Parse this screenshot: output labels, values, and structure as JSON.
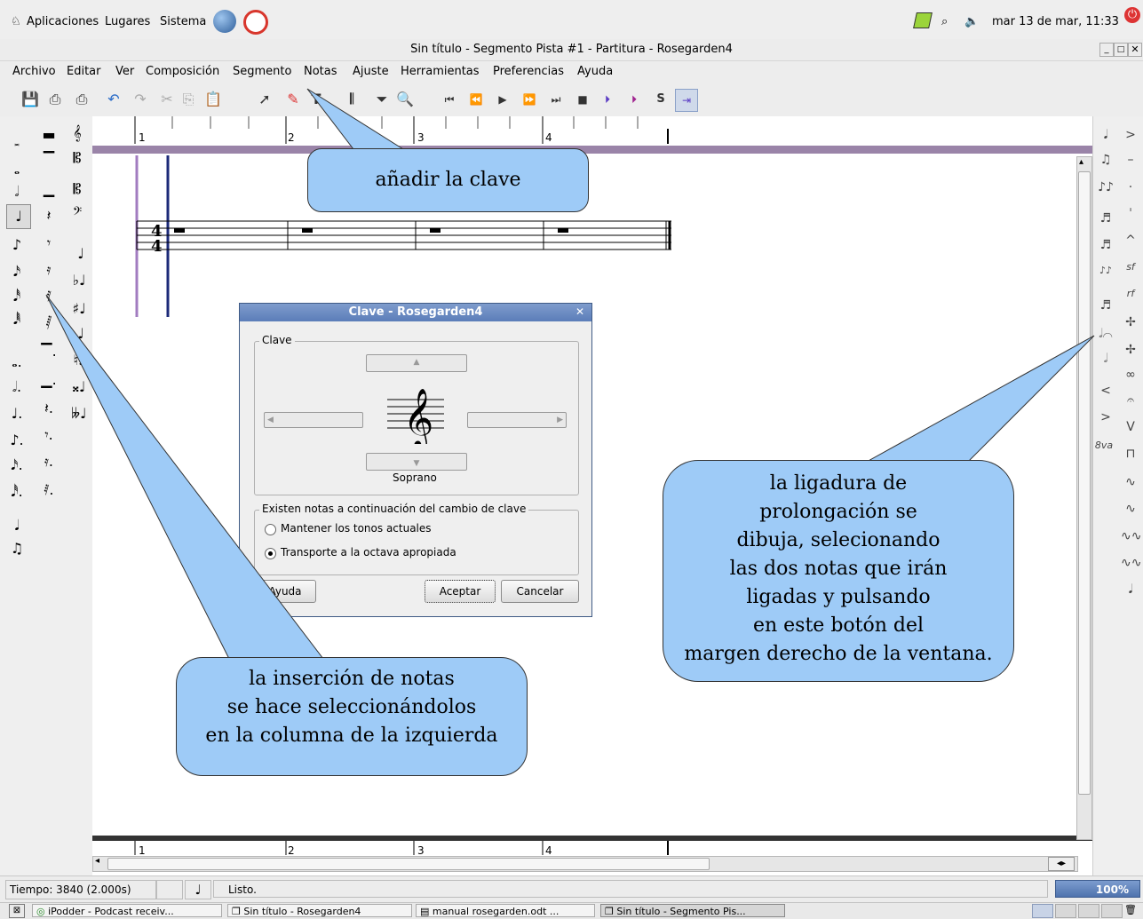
{
  "panel": {
    "applications": "Aplicaciones",
    "places": "Lugares",
    "system": "Sistema",
    "datetime": "mar 13 de mar, 11:33"
  },
  "window": {
    "title": "Sin título - Segmento Pista #1 - Partitura - Rosegarden4"
  },
  "menu": [
    "Archivo",
    "Editar",
    "Ver",
    "Composición",
    "Segmento",
    "Notas",
    "Ajuste",
    "Herramientas",
    "Preferencias",
    "Ayuda"
  ],
  "ruler": {
    "measures": [
      "1",
      "2",
      "3",
      "4"
    ]
  },
  "time_signature": {
    "top": "4",
    "bottom": "4"
  },
  "dialog": {
    "title": "Clave - Rosegarden4",
    "group_clef": "Clave",
    "clef_name": "Soprano",
    "group_notes": "Existen notas a continuación del cambio de clave",
    "option_keep": "Mantener los tonos actuales",
    "option_transpose": "Transporte a la octava apropiada",
    "selected_option": "transpose",
    "help": "Ayuda",
    "accept": "Aceptar",
    "cancel": "Cancelar"
  },
  "callouts": {
    "clef": "añadir la clave",
    "notes": [
      "la inserción de notas",
      "se hace seleccionándolos",
      "en la columna de la izquierda"
    ],
    "tie": [
      "la ligadura de",
      "prolongación se",
      "dibuja, selecionando",
      "las dos notas que irán",
      "ligadas y pulsando",
      "en este botón del",
      "margen derecho de la ventana."
    ]
  },
  "status": {
    "time": "Tiempo: 3840 (2.000s)",
    "message": "Listo.",
    "zoom": "100%"
  },
  "taskbar": [
    "iPodder - Podcast receiv...",
    "Sin título - Rosegarden4",
    "manual rosegarden.odt ...",
    "Sin título - Segmento Pis..."
  ],
  "colors": {
    "callout": "#9ecbf7",
    "purple_bar": "#9a84a8",
    "dialog_title": "#5b7db9"
  }
}
